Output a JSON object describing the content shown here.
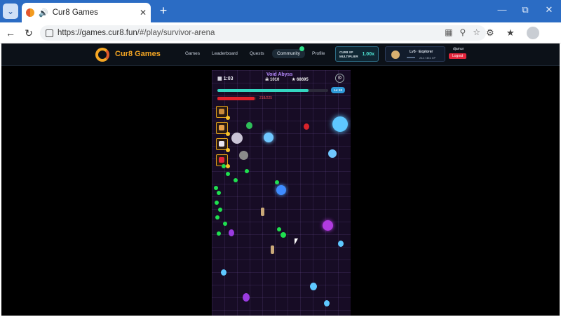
{
  "browser": {
    "tab_title": "Cur8 Games",
    "url_host": "https://games.cur8.fun",
    "url_path": "/#/play/survivor-arena",
    "icons": [
      "tab-menu-icon",
      "audio-icon",
      "close-icon",
      "plus-icon",
      "minimize-icon",
      "restore-icon",
      "close-window-icon",
      "back-icon",
      "reload-icon",
      "lock-icon",
      "apps-icon",
      "zoom-icon",
      "star-icon",
      "extensions-icon",
      "favorites-icon",
      "profile-avatar"
    ]
  },
  "site": {
    "brand": "Cur8 Games",
    "menu": [
      "Games",
      "Leaderboard",
      "Quests",
      "Community",
      "Profile"
    ],
    "xp_label_1": "CUR8 XP",
    "xp_label_2": "MULTIPLIER",
    "multiplier": "1.00x",
    "level": "Lv5 · Explorer",
    "xp_progress": "242 / 351 XP",
    "username": "djamur",
    "logout": "Logout"
  },
  "game": {
    "timer": "1:03",
    "level_name": "Void Abyss",
    "kills": "1010",
    "gems": "68695",
    "level_badge": "Lv 13",
    "hp": "218/225",
    "xp_fraction": 0.82,
    "hp_fraction": 0.97,
    "colors": {
      "accent": "#f5a623",
      "xp": "#34d6c0",
      "hp": "#e2222b",
      "level_name": "#b78aff"
    }
  }
}
